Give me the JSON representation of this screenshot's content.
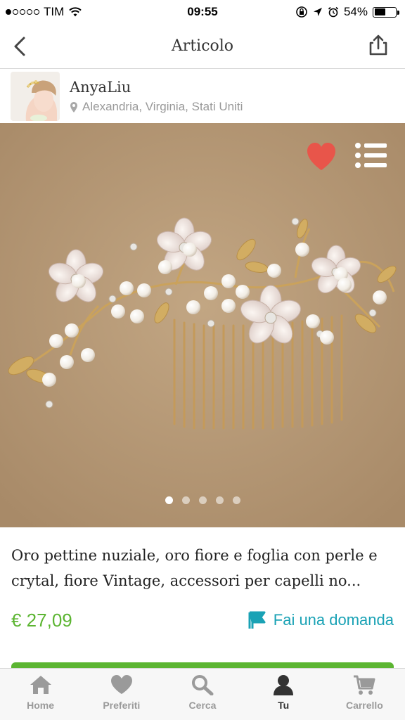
{
  "status_bar": {
    "carrier": "TIM",
    "time": "09:55",
    "battery": "54%",
    "battery_level": 0.54
  },
  "nav": {
    "title": "Articolo",
    "back_icon": "chevron-left-icon",
    "share_icon": "share-icon"
  },
  "seller": {
    "name": "AnyaLiu",
    "location": "Alexandria, Virginia, Stati Uniti"
  },
  "gallery": {
    "image_count": 5,
    "active_index": 0,
    "favorite_icon": "heart-icon",
    "list_icon": "list-icon"
  },
  "product": {
    "title": "Oro pettine nuziale, oro fiore e foglia con perle e crytal, fiore Vintage, accessori per capelli no...",
    "price": "€ 27,09",
    "ask_label": "Fai una domanda"
  },
  "colors": {
    "price_green": "#5cb532",
    "ask_teal": "#1aa2b5",
    "heart_red": "#e8554a",
    "tab_inactive": "#9a9a9a",
    "tab_active": "#333333"
  },
  "tabs": [
    {
      "label": "Home",
      "icon": "home-icon",
      "active": false
    },
    {
      "label": "Preferiti",
      "icon": "heart-icon",
      "active": false
    },
    {
      "label": "Cerca",
      "icon": "search-icon",
      "active": false
    },
    {
      "label": "Tu",
      "icon": "user-icon",
      "active": true
    },
    {
      "label": "Carrello",
      "icon": "cart-icon",
      "active": false
    }
  ]
}
